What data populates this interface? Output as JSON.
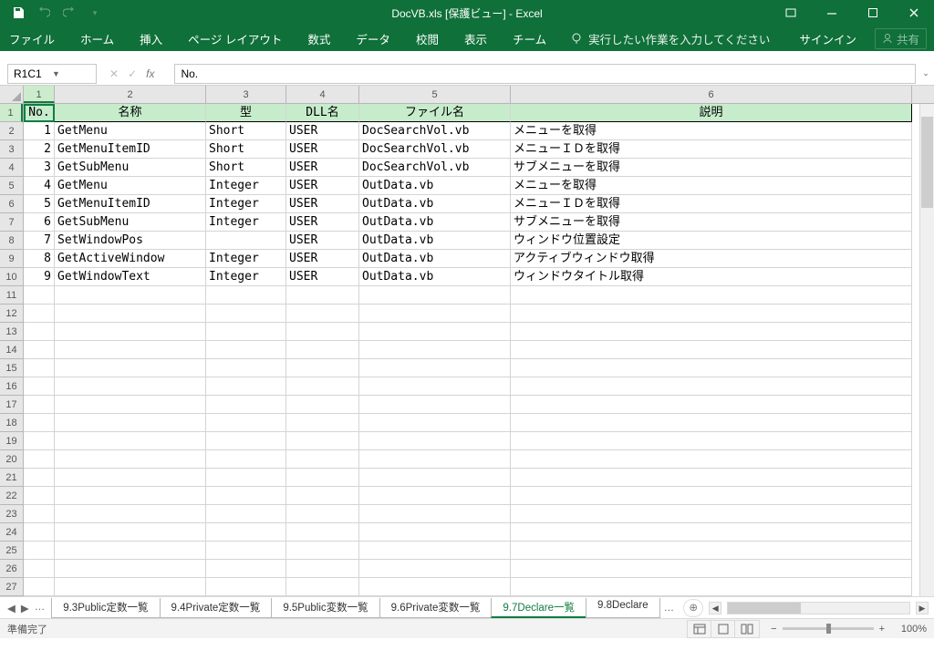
{
  "titlebar": {
    "title": "DocVB.xls  [保護ビュー] - Excel"
  },
  "ribbon": {
    "file": "ファイル",
    "home": "ホーム",
    "insert": "挿入",
    "pageLayout": "ページ レイアウト",
    "formulas": "数式",
    "data": "データ",
    "review": "校閲",
    "view": "表示",
    "team": "チーム",
    "tellMe": "実行したい作業を入力してください",
    "signIn": "サインイン",
    "share": "共有"
  },
  "fxbar": {
    "nameBox": "R1C1",
    "formula": "No."
  },
  "colHeads": [
    "1",
    "2",
    "3",
    "4",
    "5",
    "6"
  ],
  "headers": {
    "c1": "No.",
    "c2": "名称",
    "c3": "型",
    "c4": "DLL名",
    "c5": "ファイル名",
    "c6": "説明"
  },
  "rows": [
    {
      "no": "1",
      "name": "GetMenu",
      "type": "Short",
      "dll": "USER",
      "file": "DocSearchVol.vb",
      "desc": "メニューを取得"
    },
    {
      "no": "2",
      "name": "GetMenuItemID",
      "type": "Short",
      "dll": "USER",
      "file": "DocSearchVol.vb",
      "desc": "メニューＩＤを取得"
    },
    {
      "no": "3",
      "name": "GetSubMenu",
      "type": "Short",
      "dll": "USER",
      "file": "DocSearchVol.vb",
      "desc": "サブメニューを取得"
    },
    {
      "no": "4",
      "name": "GetMenu",
      "type": "Integer",
      "dll": "USER",
      "file": "OutData.vb",
      "desc": "メニューを取得"
    },
    {
      "no": "5",
      "name": "GetMenuItemID",
      "type": "Integer",
      "dll": "USER",
      "file": "OutData.vb",
      "desc": "メニューＩＤを取得"
    },
    {
      "no": "6",
      "name": "GetSubMenu",
      "type": "Integer",
      "dll": "USER",
      "file": "OutData.vb",
      "desc": "サブメニューを取得"
    },
    {
      "no": "7",
      "name": "SetWindowPos",
      "type": "",
      "dll": "USER",
      "file": "OutData.vb",
      "desc": "ウィンドウ位置設定"
    },
    {
      "no": "8",
      "name": "GetActiveWindow",
      "type": "Integer",
      "dll": "USER",
      "file": "OutData.vb",
      "desc": "アクティブウィンドウ取得"
    },
    {
      "no": "9",
      "name": "GetWindowText",
      "type": "Integer",
      "dll": "USER",
      "file": "OutData.vb",
      "desc": "ウィンドウタイトル取得"
    }
  ],
  "emptyRows": 17,
  "sheetTabs": {
    "items": [
      "9.3Public定数一覧",
      "9.4Private定数一覧",
      "9.5Public変数一覧",
      "9.6Private変数一覧",
      "9.7Declare一覧",
      "9.8Declare"
    ],
    "activeIndex": 4
  },
  "status": {
    "ready": "準備完了",
    "zoom": "100%"
  }
}
